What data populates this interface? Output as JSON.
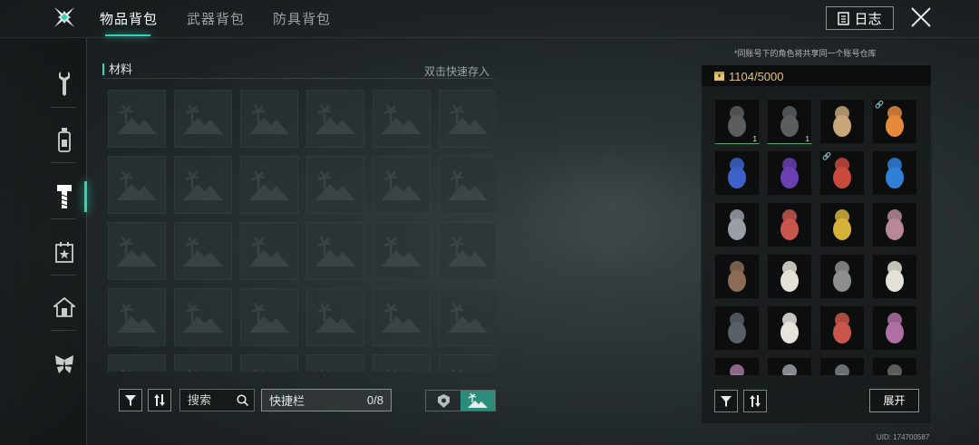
{
  "topbar": {
    "tabs": [
      {
        "label": "物品背包",
        "active": true
      },
      {
        "label": "武器背包",
        "active": false
      },
      {
        "label": "防具背包",
        "active": false
      }
    ],
    "log_label": "日志",
    "accent_color": "#35d2b7"
  },
  "sidebar": {
    "items": [
      {
        "icon": "wrench-icon",
        "active": false
      },
      {
        "icon": "bottle-icon",
        "active": false
      },
      {
        "icon": "bolt-icon",
        "active": true
      },
      {
        "icon": "calendar-star-icon",
        "active": false
      },
      {
        "icon": "house-icon",
        "active": false
      },
      {
        "icon": "butterfly-icon",
        "active": false
      }
    ]
  },
  "inventory": {
    "section_title": "材料",
    "quick_store_label": "双击快速存入",
    "empty_slot_icon": "island-palm-icon",
    "visible_rows": 5,
    "columns": 6
  },
  "toolbar": {
    "filter_icon": "funnel-icon",
    "sort_icon": "sort-arrows-icon",
    "search_placeholder": "搜索",
    "quickbar_label": "快捷栏",
    "quickbar_count": "0/8",
    "toggle_options": [
      "badge-icon",
      "island-palm-icon"
    ],
    "toggle_active": 1
  },
  "warehouse": {
    "notice": "*同账号下的角色将共享同一个账号仓库",
    "capacity": "1104/5000",
    "capacity_icon": "chest-icon",
    "items": [
      {
        "name": "item-dark-bust",
        "count": "1",
        "color": "#5a5e5f"
      },
      {
        "name": "item-dark-bust",
        "count": "1",
        "color": "#5a5e5f"
      },
      {
        "name": "item-box-doll",
        "color": "#c9a679"
      },
      {
        "name": "item-orange-chick",
        "color": "#e58a3c",
        "linked": true
      },
      {
        "name": "item-blue-card",
        "color": "#3e62c9"
      },
      {
        "name": "item-purple-dragon",
        "color": "#6a3fb0"
      },
      {
        "name": "item-red-robot",
        "color": "#c84a3c",
        "linked": true
      },
      {
        "name": "item-blue-crystal",
        "color": "#2f7fd6"
      },
      {
        "name": "item-grey-rabbit",
        "color": "#9a9fa6"
      },
      {
        "name": "item-red-mushroom",
        "color": "#c8564d"
      },
      {
        "name": "item-yellow-scarecrow",
        "color": "#d5b33a"
      },
      {
        "name": "item-purple-mushroom",
        "color": "#b7889a"
      },
      {
        "name": "item-wooden-puppet",
        "color": "#8b6b55"
      },
      {
        "name": "item-white-onion",
        "color": "#e3e1d8"
      },
      {
        "name": "item-grey-cat",
        "color": "#8e8e8e"
      },
      {
        "name": "item-white-onion",
        "color": "#e3e1d8"
      },
      {
        "name": "item-dark-ghost",
        "color": "#596068"
      },
      {
        "name": "item-voodoo-doll",
        "color": "#e8e4dd"
      },
      {
        "name": "item-red-mushroom",
        "color": "#c8564d"
      },
      {
        "name": "item-purple-onion",
        "color": "#b06fa2"
      },
      {
        "name": "item-partial-1",
        "color": "#a5779e"
      },
      {
        "name": "item-partial-2",
        "color": "#9a9fa6"
      },
      {
        "name": "item-partial-3",
        "color": "#7a7f85"
      },
      {
        "name": "item-partial-4",
        "color": "#6d6a66"
      }
    ],
    "expand_label": "展开",
    "uid": "UID: 174700587"
  }
}
